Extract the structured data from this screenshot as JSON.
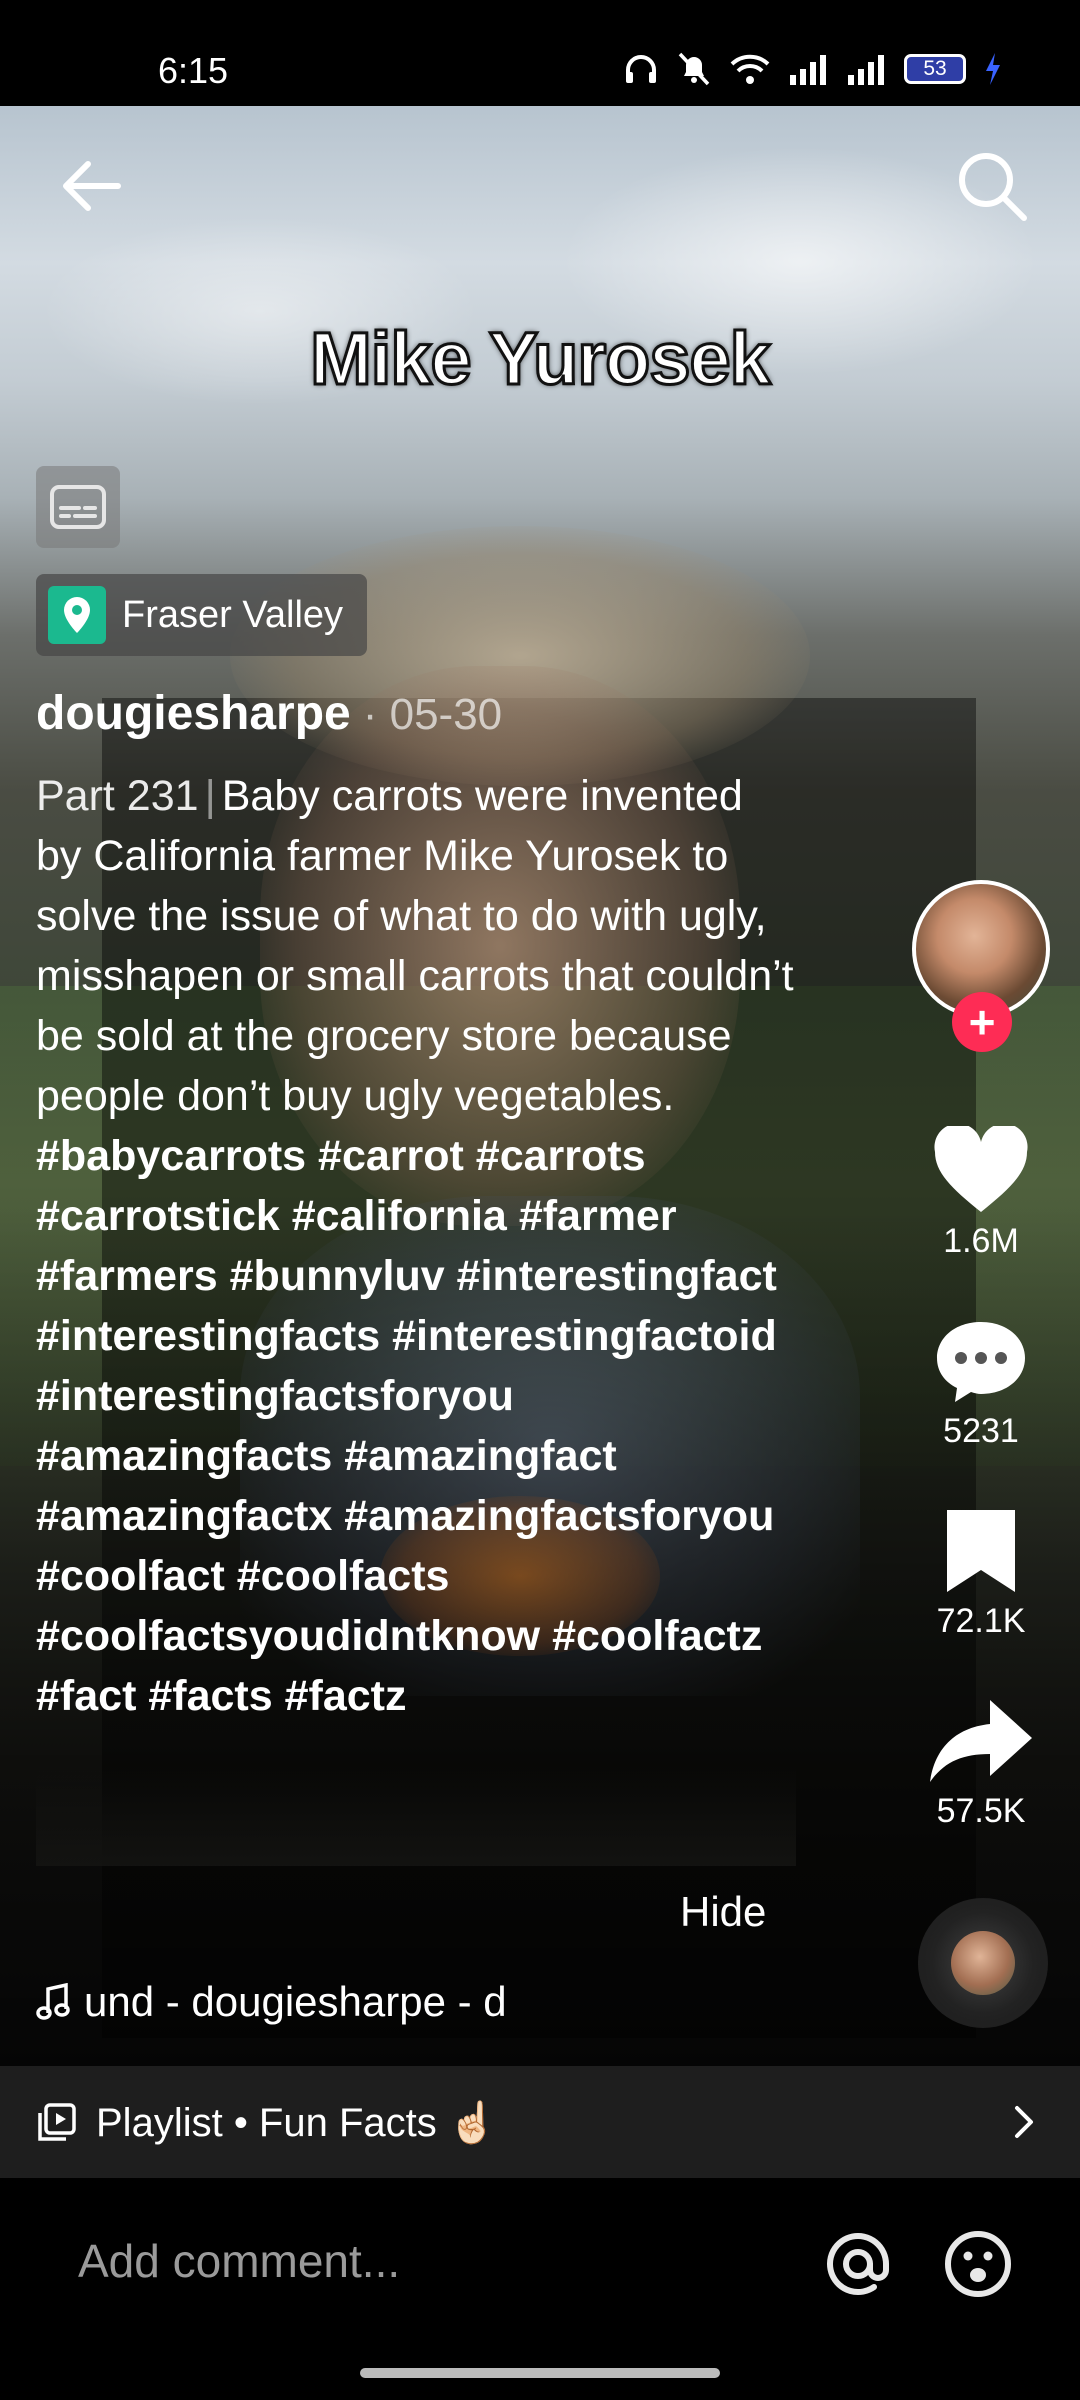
{
  "status_bar": {
    "time": "6:15",
    "battery": "53"
  },
  "video": {
    "caption_overlay": "Mike Yurosek"
  },
  "location": {
    "label": "Fraser Valley"
  },
  "post": {
    "author": "dougiesharpe",
    "date": "· 05-30",
    "part": "Part 231",
    "separator": "|",
    "text": "Baby carrots were invented by California farmer Mike Yurosek to solve the issue of what to do with ugly, misshapen or small carrots that couldn’t be sold at the grocery store because people don’t buy ugly vegetables.",
    "hashtags": [
      "#babycarrots",
      "#carrot",
      "#carrots",
      "#carrotstick",
      "#california",
      "#farmer",
      "#farmers",
      "#bunnyluv",
      "#interestingfact",
      "#interestingfacts",
      "#interestingfactoid",
      "#interestingfactsforyou",
      "#amazingfacts",
      "#amazingfact",
      "#amazingfactx",
      "#amazingfactsforyou",
      "#coolfact",
      "#coolfacts",
      "#coolfactsyoudidntknow",
      "#coolfactz",
      "#fact",
      "#facts",
      "#factz"
    ],
    "hide_label": "Hide"
  },
  "sound": {
    "label": "und - dougiesharpe - d"
  },
  "actions": {
    "likes": "1.6M",
    "comments": "5231",
    "saves": "72.1K",
    "shares": "57.5K"
  },
  "playlist": {
    "label": "Playlist • Fun Facts ☝🏻"
  },
  "comment_bar": {
    "placeholder": "Add comment..."
  },
  "icons": {
    "back": "arrow-left-icon",
    "search": "search-icon",
    "captions": "closed-captions-icon",
    "location": "location-pin-icon",
    "like": "heart-icon",
    "comment": "comment-bubble-icon",
    "save": "bookmark-icon",
    "share": "share-arrow-icon",
    "sound": "music-note-icon",
    "playlist": "playlist-icon",
    "mention": "at-sign-icon",
    "emoji": "emoji-icon"
  },
  "colors": {
    "accent": "#fe2c55",
    "location_pin": "#1bb98f",
    "playlist_bg": "#1e1e1e"
  }
}
